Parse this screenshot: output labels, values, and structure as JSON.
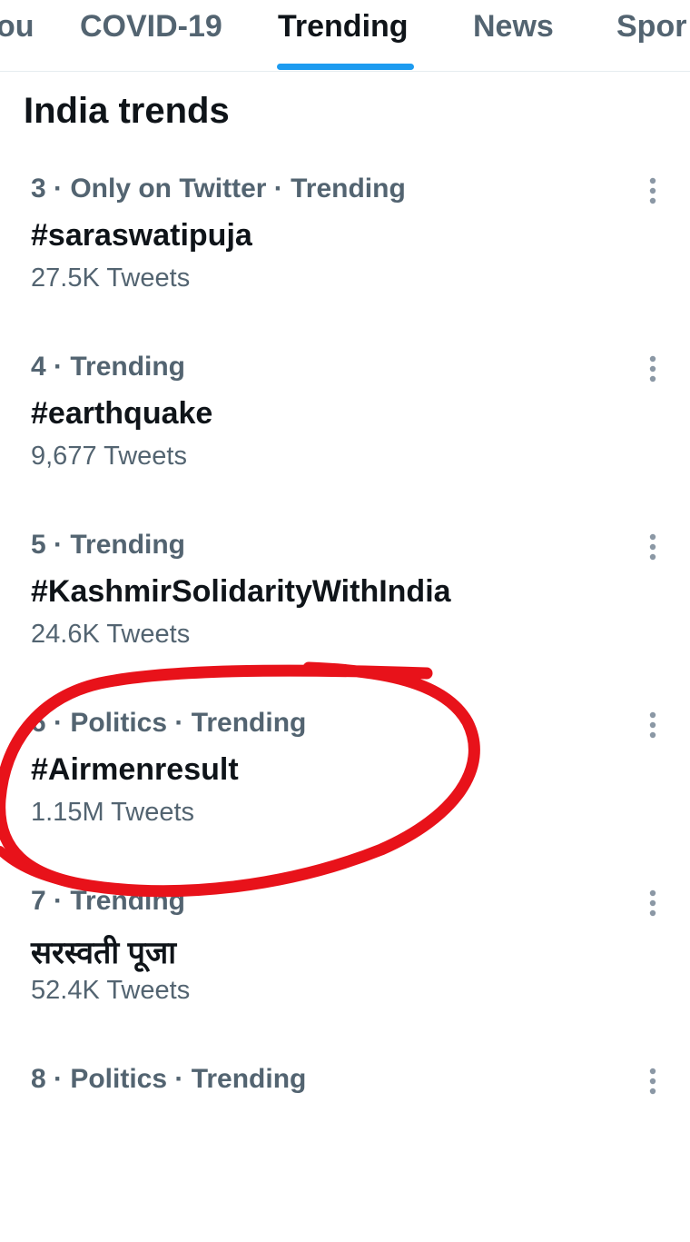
{
  "tabs": [
    {
      "label": "ou"
    },
    {
      "label": "COVID-19"
    },
    {
      "label": "Trending"
    },
    {
      "label": "News"
    },
    {
      "label": "Spor"
    }
  ],
  "section_title": "India trends",
  "trends": [
    {
      "meta": "3 · Only on Twitter · Trending",
      "name": "#saraswatipuja",
      "count": "27.5K Tweets"
    },
    {
      "meta": "4 · Trending",
      "name": "#earthquake",
      "count": "9,677 Tweets"
    },
    {
      "meta": "5 · Trending",
      "name": "#KashmirSolidarityWithIndia",
      "count": "24.6K Tweets"
    },
    {
      "meta": "6 · Politics · Trending",
      "name": "#Airmenresult",
      "count": "1.15M Tweets"
    },
    {
      "meta": "7 · Trending",
      "name": "सरस्वती पूजा",
      "count": "52.4K Tweets"
    },
    {
      "meta": "8 · Politics · Trending",
      "name": "",
      "count": ""
    }
  ],
  "colors": {
    "accent": "#1d9bf0",
    "annotation": "#e8121a"
  },
  "icons": {
    "more": "more-vertical-icon"
  }
}
